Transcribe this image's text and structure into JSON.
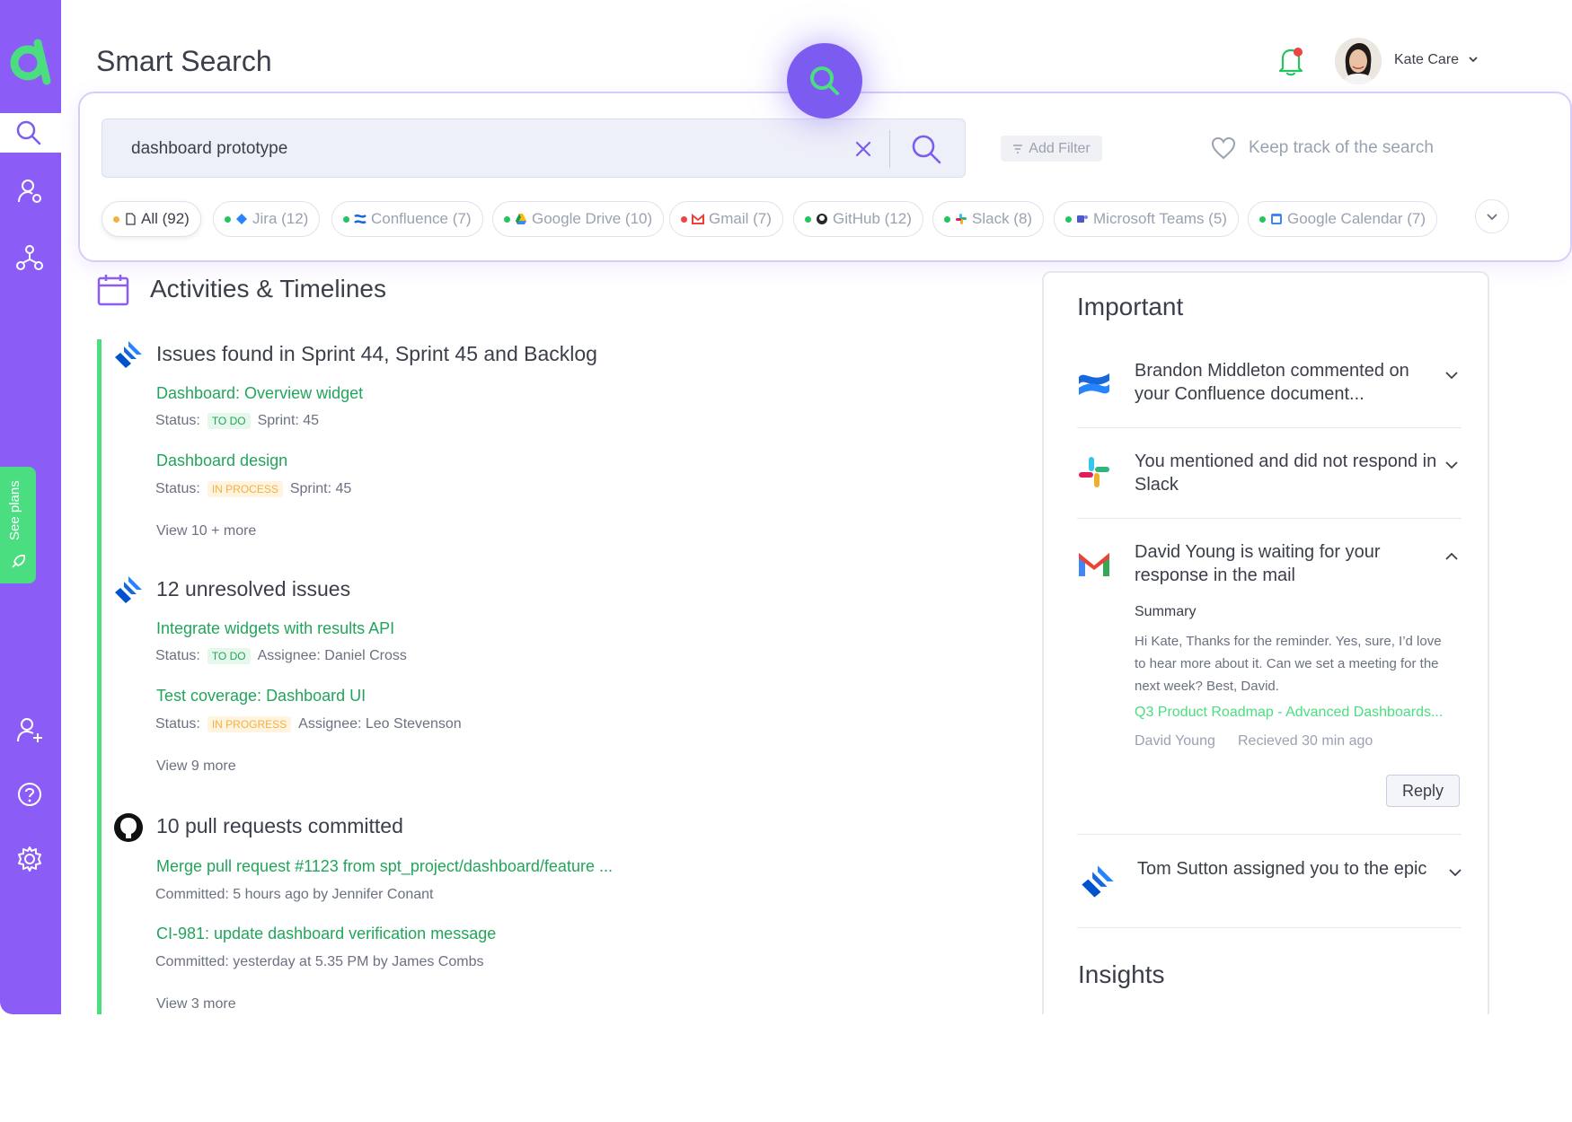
{
  "header": {
    "title": "Smart Search",
    "user_name": "Kate Care"
  },
  "search": {
    "query": "dashboard prototype",
    "add_filter": "Add Filter",
    "keep_track": "Keep track of the search"
  },
  "filters": [
    {
      "label": "All (92)"
    },
    {
      "label": "Jira (12)"
    },
    {
      "label": "Confluence (7)"
    },
    {
      "label": "Google Drive (10)"
    },
    {
      "label": "Gmail (7)"
    },
    {
      "label": "GitHub (12)"
    },
    {
      "label": "Slack (8)"
    },
    {
      "label": "Microsoft Teams (5)"
    },
    {
      "label": "Google Calendar (7)"
    }
  ],
  "sidebar": {
    "see_plans": "See plans"
  },
  "activities": {
    "title": "Activities & Timelines",
    "groups": [
      {
        "title": "Issues found in Sprint 44, Sprint 45 and Backlog",
        "items": [
          {
            "title": "Dashboard: Overview widget",
            "status_label": "Status:",
            "status": "TO DO",
            "extra": "Sprint: 45"
          },
          {
            "title": "Dashboard design",
            "status_label": "Status:",
            "status": "IN PROCESS",
            "extra": "Sprint: 45"
          }
        ],
        "more": "View 10 + more"
      },
      {
        "title": "12 unresolved issues",
        "items": [
          {
            "title": "Integrate widgets with results API",
            "status_label": "Status:",
            "status": "TO DO",
            "extra": "Assignee: Daniel Cross"
          },
          {
            "title": "Test coverage: Dashboard UI",
            "status_label": "Status:",
            "status": "IN PROGRESS",
            "extra": "Assignee: Leo Stevenson"
          }
        ],
        "more": "View 9 more"
      },
      {
        "title": "10 pull requests committed",
        "items": [
          {
            "title": "Merge pull request #1123 from spt_project/dashboard/feature ...",
            "meta": "Committed: 5 hours ago by Jennifer Conant"
          },
          {
            "title": "CI-981: update dashboard verification message",
            "meta": "Committed: yesterday at 5.35 PM by James Combs"
          }
        ],
        "more": "View 3 more"
      }
    ]
  },
  "important": {
    "title": "Important",
    "items": [
      {
        "text": "Brandon Middleton commented on your Confluence document...",
        "icon": "confluence-icon"
      },
      {
        "text": "You mentioned and did not respond in Slack",
        "icon": "slack-icon"
      },
      {
        "text": "David Young is waiting for your response in the mail",
        "icon": "gmail-icon"
      },
      {
        "text": "Tom Sutton assigned you to the epic",
        "icon": "jira-icon"
      }
    ],
    "summary": {
      "label": "Summary",
      "text": "Hi Kate, Thanks for the reminder. Yes, sure, I’d love to hear more about it. Can we set a meeting for the next week? Best, David.",
      "link": "Q3 Product Roadmap - Advanced Dashboards...",
      "from": "David Young",
      "received": "Recieved 30 min ago",
      "reply": "Reply"
    },
    "insights": "Insights"
  },
  "colors": {
    "accent": "#8b5cf6",
    "green": "#22a55b",
    "todo_badge": "#22a55b",
    "progress_badge": "#f5b041"
  }
}
